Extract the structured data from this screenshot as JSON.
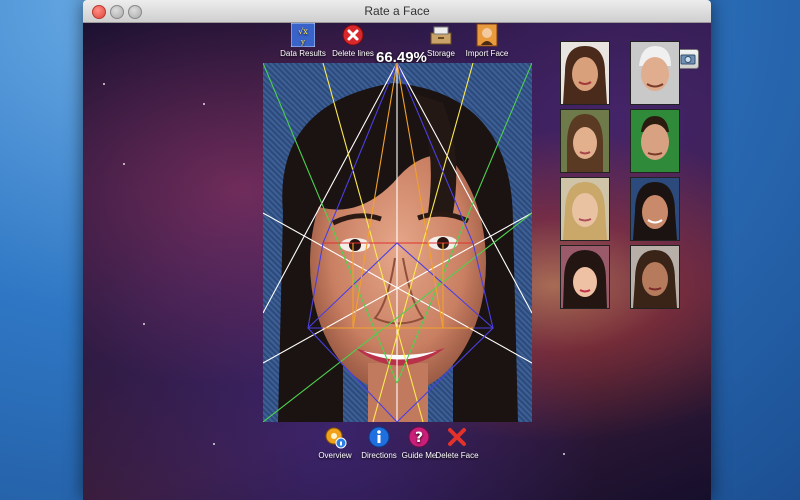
{
  "window": {
    "title": "Rate a Face"
  },
  "toolbar": {
    "data_results": "Data Results",
    "delete_lines": "Delete lines",
    "score": "66.49%",
    "storage": "Storage",
    "import_face": "Import Face"
  },
  "bottom_toolbar": {
    "overview": "Overview",
    "directions": "Directions",
    "guide_me": "Guide Me",
    "delete_face": "Delete Face"
  },
  "thumbnails": [
    "face-1",
    "face-2",
    "face-3",
    "face-4",
    "face-5",
    "face-6",
    "face-7",
    "face-8"
  ]
}
